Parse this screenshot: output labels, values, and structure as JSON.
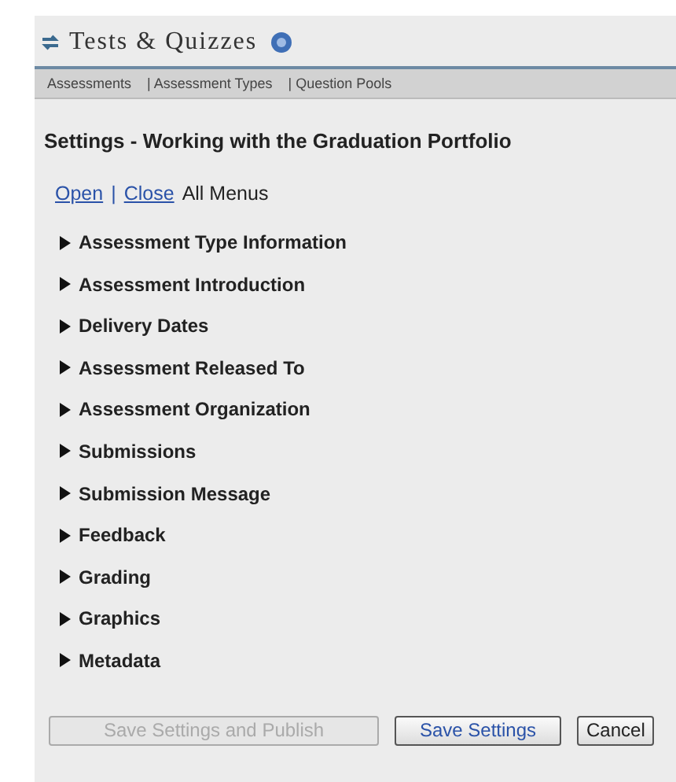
{
  "header": {
    "title": "Tests & Quizzes"
  },
  "nav": [
    {
      "label": "Assessments"
    },
    {
      "label": "| Assessment Types"
    },
    {
      "label": "| Question Pools"
    }
  ],
  "heading": "Settings - Working with the Graduation Portfolio",
  "menu_controls": {
    "open": "Open",
    "separator": "|",
    "close": "Close",
    "suffix": "All Menus"
  },
  "sections": [
    {
      "label": "Assessment Type Information",
      "expanded": false
    },
    {
      "label": "Assessment Introduction",
      "expanded": false
    },
    {
      "label": "Delivery Dates",
      "expanded": false
    },
    {
      "label": "Assessment Released To",
      "expanded": false
    },
    {
      "label": "Assessment Organization",
      "expanded": false
    },
    {
      "label": "Submissions",
      "expanded": false
    },
    {
      "label": "Submission Message",
      "expanded": false
    },
    {
      "label": "Feedback",
      "expanded": false
    },
    {
      "label": "Grading",
      "expanded": false
    },
    {
      "label": "Graphics",
      "expanded": false
    },
    {
      "label": "Metadata",
      "expanded": false
    }
  ],
  "buttons": [
    {
      "label": "Save Settings and Publish",
      "kind": "secondary",
      "disabled": true
    },
    {
      "label": "Save Settings",
      "kind": "primary",
      "disabled": false
    },
    {
      "label": "Cancel",
      "kind": "secondary",
      "disabled": false
    }
  ]
}
